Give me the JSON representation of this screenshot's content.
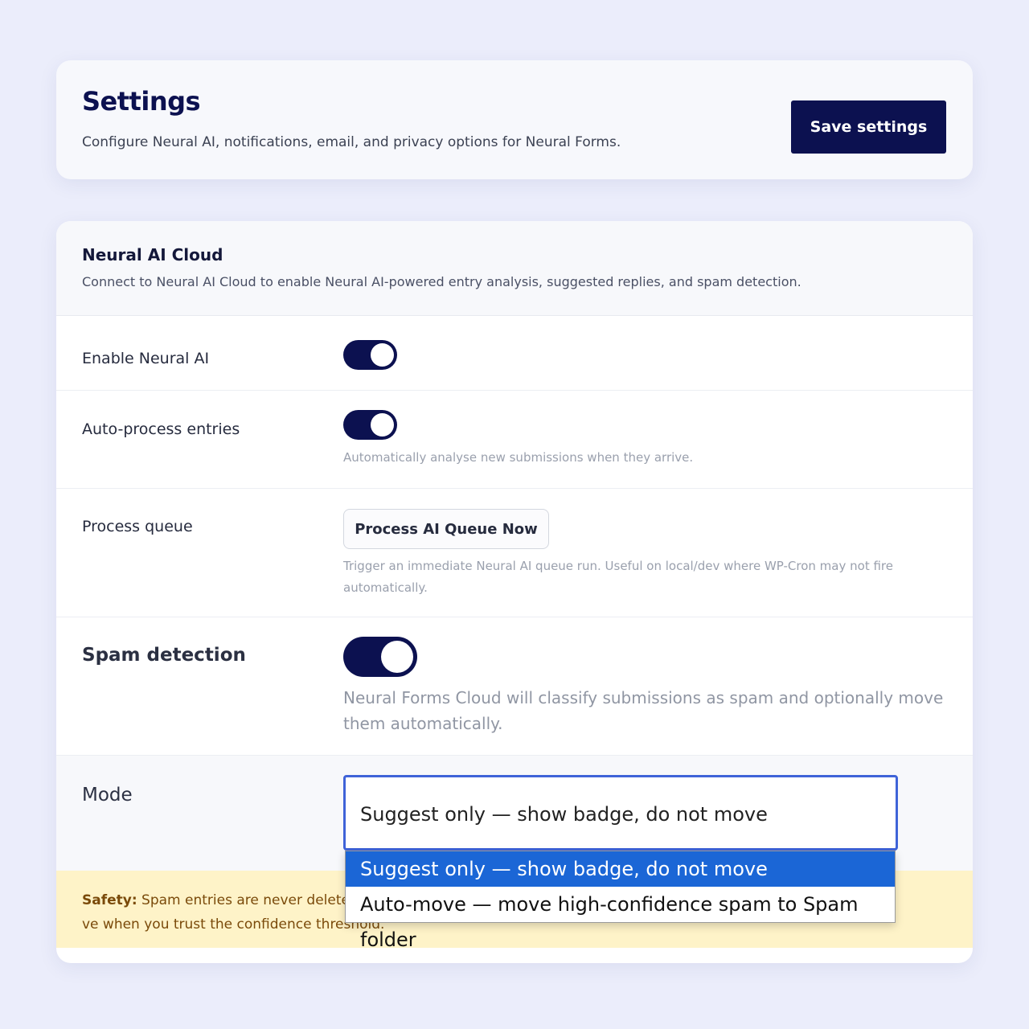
{
  "header": {
    "title": "Settings",
    "subtitle": "Configure Neural AI, notifications, email, and privacy options for Neural Forms.",
    "save_label": "Save settings"
  },
  "section": {
    "title": "Neural AI Cloud",
    "description": "Connect to Neural AI Cloud to enable Neural AI-powered entry analysis, suggested replies, and spam detection."
  },
  "rows": {
    "enable_ai": {
      "label": "Enable Neural AI",
      "enabled": true
    },
    "auto_process": {
      "label": "Auto-process entries",
      "enabled": true,
      "help": "Automatically analyse new submissions when they arrive."
    },
    "queue": {
      "label": "Process queue",
      "button_label": "Process AI Queue Now",
      "help": "Trigger an immediate Neural AI queue run. Useful on local/dev where WP-Cron may not fire automatically."
    },
    "spam": {
      "label": "Spam detection",
      "enabled": true,
      "help": "Neural Forms Cloud will classify submissions as spam and optionally move them automatically."
    },
    "mode": {
      "label": "Mode",
      "selected": "Suggest only — show badge, do not move",
      "options": [
        "Suggest only — show badge, do not move",
        "Auto-move — move high-confidence spam to Spam folder"
      ]
    }
  },
  "safety": {
    "label": "Safety:",
    "text_before": " Spam entries are never deleted a",
    "text_after": "ve when you trust the confidence threshold."
  },
  "colors": {
    "accent": "#0c1150",
    "select_focus": "#3f63d8",
    "option_highlight": "#1b66d6",
    "safety_bg": "#fef3c8"
  }
}
